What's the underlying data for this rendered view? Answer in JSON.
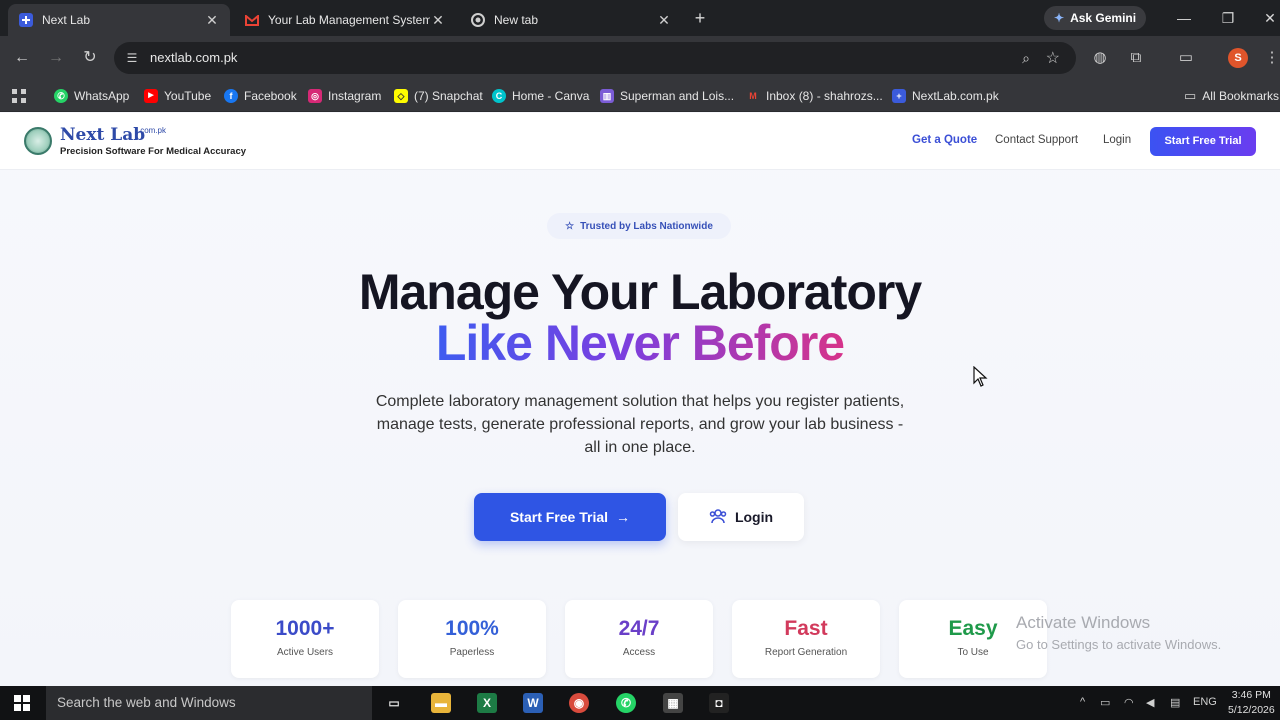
{
  "browser": {
    "tabs": [
      {
        "title": "Next Lab",
        "icon": "nextlab-favicon-icon",
        "active": true
      },
      {
        "title": "Your Lab Management System",
        "icon": "gmail-icon",
        "active": false
      },
      {
        "title": "New tab",
        "icon": "chrome-icon",
        "active": false
      }
    ],
    "gemini_label": "Ask Gemini",
    "url": "nextlab.com.pk",
    "profile_initial": "S",
    "bookmarks": [
      {
        "label": "WhatsApp",
        "icon": "whatsapp-icon",
        "color": "#25d366"
      },
      {
        "label": "YouTube",
        "icon": "youtube-icon",
        "color": "#ff0000"
      },
      {
        "label": "Facebook",
        "icon": "facebook-icon",
        "color": "#1877f2"
      },
      {
        "label": "Instagram",
        "icon": "instagram-icon",
        "color": "#d62976"
      },
      {
        "label": "(7) Snapchat",
        "icon": "snapchat-icon",
        "color": "#fffc00"
      },
      {
        "label": "Home - Canva",
        "icon": "canva-icon",
        "color": "#00c4cc"
      },
      {
        "label": "Superman and Lois...",
        "icon": "bookmark-site-icon",
        "color": "#7b5cd6"
      },
      {
        "label": "Inbox (8) - shahrozs...",
        "icon": "gmail-icon",
        "color": "#ea4335"
      },
      {
        "label": "NextLab.com.pk",
        "icon": "nextlab-favicon-icon",
        "color": "#3b5bdb"
      }
    ],
    "all_bookmarks": "All Bookmarks"
  },
  "site": {
    "logo_name": "Next Lab",
    "logo_suffix": ".com.pk",
    "logo_tagline": "Precision Software For Medical Accuracy",
    "nav": {
      "get_quote": "Get a Quote",
      "contact_support": "Contact Support",
      "login": "Login",
      "cta": "Start Free Trial"
    },
    "badge": "Trusted by Labs Nationwide",
    "hero_line1": "Manage Your Laboratory",
    "hero_line2": "Like Never Before",
    "hero_sub": "Complete laboratory management solution that helps you register patients, manage tests, generate professional reports, and grow your lab business - all in one place.",
    "btn_primary": "Start Free Trial",
    "btn_secondary": "Login",
    "stats": [
      {
        "value": "1000+",
        "label": "Active Users",
        "color": "#3b4bc8"
      },
      {
        "value": "100%",
        "label": "Paperless",
        "color": "#3460d8"
      },
      {
        "value": "24/7",
        "label": "Access",
        "color": "#6a3fc8"
      },
      {
        "value": "Fast",
        "label": "Report Generation",
        "color": "#d23a5c"
      },
      {
        "value": "Easy",
        "label": "To Use",
        "color": "#1f9a4a"
      }
    ]
  },
  "watermark": {
    "line1": "Activate Windows",
    "line2": "Go to Settings to activate Windows."
  },
  "taskbar": {
    "search_placeholder": "Search the web and Windows",
    "language": "ENG",
    "time": "3:46 PM",
    "date": "5/12/2026"
  }
}
